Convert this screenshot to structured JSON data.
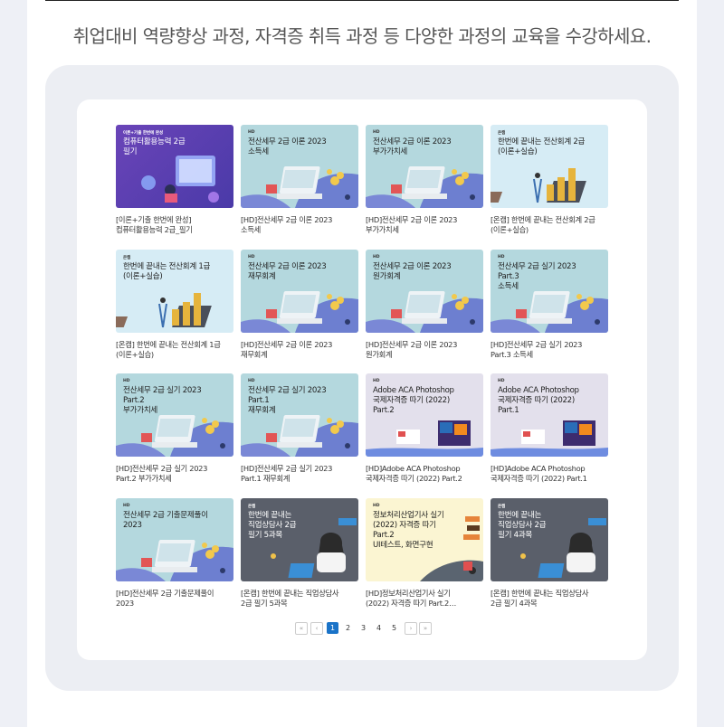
{
  "subtitle": "취업대비 역량향상 과정, 자격증 취득 과정 등 다양한 과정의 교육을 수강하세요.",
  "courses": [
    {
      "tag": "이론+기출 한번에 완성",
      "title": "컴퓨터활용능력 2급\n필기",
      "caption": "[이론+기출 한번에 완성]\n컴퓨터활용능력 2급_필기",
      "style": "purple",
      "art": "computer"
    },
    {
      "tag": "HD",
      "title": "전산세무 2급 이론 2023\n소득세",
      "caption": "[HD]전산세무 2급 이론 2023\n소득세",
      "style": "teal",
      "art": "laptop"
    },
    {
      "tag": "HD",
      "title": "전산세무 2급 이론 2023\n부가가치세",
      "caption": "[HD]전산세무 2급 이론 2023\n부가가치세",
      "style": "teal",
      "art": "laptop"
    },
    {
      "tag": "온캠",
      "title": "한번에 끝내는 전산회계 2급\n(이론+실습)",
      "caption": "[온캠] 한번에 끝내는 전산회계 2급\n(이론+실습)",
      "style": "light",
      "art": "coins"
    },
    {
      "tag": "온캠",
      "title": "한번에 끝내는 전산회계 1급\n(이론+실습)",
      "caption": "[온캠] 한번에 끝내는 전산회계 1급\n(이론+실습)",
      "style": "light",
      "art": "coins"
    },
    {
      "tag": "HD",
      "title": "전산세무 2급 이론 2023\n재무회계",
      "caption": "[HD]전산세무 2급 이론 2023\n재무회계",
      "style": "teal",
      "art": "laptop"
    },
    {
      "tag": "HD",
      "title": "전산세무 2급 이론 2023\n원가회계",
      "caption": "[HD]전산세무 2급 이론 2023\n원가회계",
      "style": "teal",
      "art": "laptop"
    },
    {
      "tag": "HD",
      "title": "전산세무 2급 실기 2023\nPart.3\n소득세",
      "caption": "[HD]전산세무 2급 실기 2023\nPart.3 소득세",
      "style": "teal",
      "art": "laptop"
    },
    {
      "tag": "HD",
      "title": "전산세무 2급 실기 2023\nPart.2\n부가가치세",
      "caption": "[HD]전산세무 2급 실기 2023\nPart.2 부가가치세",
      "style": "teal",
      "art": "laptop"
    },
    {
      "tag": "HD",
      "title": "전산세무 2급 실기 2023\nPart.1\n재무회계",
      "caption": "[HD]전산세무 2급 실기 2023\nPart.1 재무회계",
      "style": "teal",
      "art": "laptop"
    },
    {
      "tag": "HD",
      "title": "Adobe ACA Photoshop\n국제자격증 따기 (2022)\nPart.2",
      "caption": "[HD]Adobe ACA Photoshop\n국제자격증 따기 (2022) Part.2",
      "style": "lav",
      "art": "adobe"
    },
    {
      "tag": "HD",
      "title": "Adobe ACA Photoshop\n국제자격증 따기 (2022)\nPart.1",
      "caption": "[HD]Adobe ACA Photoshop\n국제자격증 따기 (2022) Part.1",
      "style": "lav",
      "art": "adobe"
    },
    {
      "tag": "HD",
      "title": "전산세무 2급 기출문제풀이\n2023",
      "caption": "[HD]전산세무 2급 기출문제풀이\n2023",
      "style": "teal",
      "art": "laptop"
    },
    {
      "tag": "온캠",
      "title": "한번에 끝내는\n직업상담사 2급\n필기 5과목",
      "caption": "[온캠] 한번에 끝내는 직업상담사\n2급 필기 5과목",
      "style": "dark",
      "art": "person"
    },
    {
      "tag": "HD",
      "title": "정보처리산업기사 실기\n(2022) 자격증 따기\nPart.2\nUI테스트, 화면구현",
      "caption": "[HD]정보처리산업기사 실기\n(2022) 자격증 따기 Part.2…",
      "style": "cream",
      "art": "tools"
    },
    {
      "tag": "온캠",
      "title": "한번에 끝내는\n직업상담사 2급\n필기 4과목",
      "caption": "[온캠] 한번에 끝내는 직업상담사\n2급 필기 4과목",
      "style": "dark",
      "art": "person"
    }
  ],
  "pagination": {
    "first": "«",
    "prev": "‹",
    "pages": [
      "1",
      "2",
      "3",
      "4",
      "5"
    ],
    "active": "1",
    "next": "›",
    "last": "»"
  }
}
